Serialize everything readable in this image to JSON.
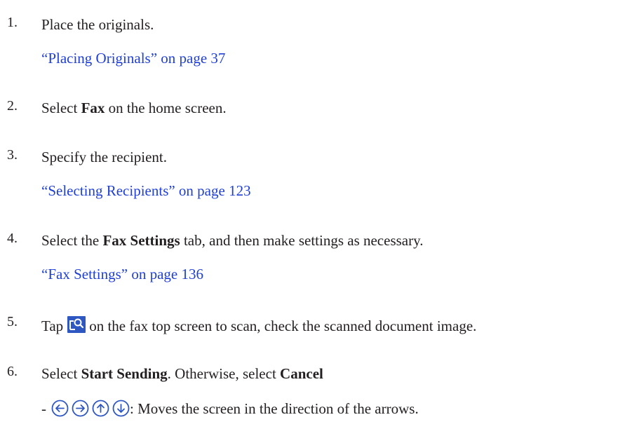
{
  "steps": [
    {
      "number": "1.",
      "text": "Place the originals.",
      "link": "“Placing Originals” on page 37"
    },
    {
      "number": "2.",
      "text_pre": "Select ",
      "text_bold": "Fax",
      "text_post": " on the home screen."
    },
    {
      "number": "3.",
      "text": "Specify the recipient.",
      "link": "“Selecting Recipients” on page 123"
    },
    {
      "number": "4.",
      "text_pre": "Select the ",
      "text_bold": "Fax Settings",
      "text_post": " tab, and then make settings as necessary.",
      "link": "“Fax Settings” on page 136"
    },
    {
      "number": "5.",
      "text_pre": "Tap",
      "icon": "preview-scan-icon",
      "text_post": "on the fax top screen to scan, check the scanned document image."
    },
    {
      "number": "6.",
      "text_pre": "Select ",
      "text_bold": "Start Sending",
      "text_mid": ". Otherwise, select ",
      "text_bold2": "Cancel",
      "sub_item": {
        "bullet": "-",
        "icons": [
          "arrow-left-icon",
          "arrow-right-icon",
          "arrow-up-icon",
          "arrow-down-icon"
        ],
        "text": ": Moves the screen in the direction of the arrows."
      }
    }
  ],
  "colors": {
    "text": "#231f20",
    "link": "#1f3fd6",
    "icon": "#2e57c2"
  }
}
